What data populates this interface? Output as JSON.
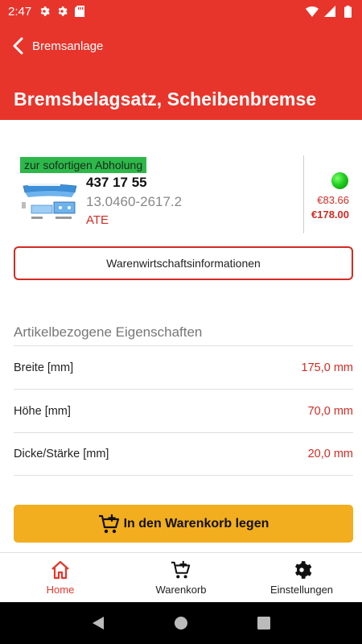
{
  "status_bar": {
    "time": "2:47",
    "left_icons": [
      "gear-icon",
      "gear-icon",
      "sd-card-icon"
    ],
    "right_icons": [
      "wifi-icon",
      "signal-icon",
      "battery-icon"
    ]
  },
  "header": {
    "back_label": "Bremsanlage",
    "title": "Bremsbelagsatz, Scheibenbremse",
    "color": "#e8352b"
  },
  "article": {
    "pickup_badge": "zur sofortigen Abholung",
    "article_number": "437 17 55",
    "reference": "13.0460-2617.2",
    "brand": "ATE",
    "stock_status_color": "#1fcf1f",
    "price_net": "€83.66",
    "price_gross": "€178.00"
  },
  "info_button": {
    "label": "Warenwirtschaftsinformationen"
  },
  "properties": {
    "title": "Artikelbezogene Eigenschaften",
    "rows": [
      {
        "label": "Breite [mm]",
        "value": "175,0 mm"
      },
      {
        "label": "Höhe [mm]",
        "value": "70,0 mm"
      },
      {
        "label": "Dicke/Stärke [mm]",
        "value": "20,0 mm"
      }
    ]
  },
  "cart_button": {
    "label": "In den Warenkorb legen",
    "color": "#f2ae1e"
  },
  "bottom_nav": {
    "items": [
      {
        "label": "Home",
        "icon": "home-icon",
        "active": true
      },
      {
        "label": "Warenkorb",
        "icon": "cart-icon",
        "active": false
      },
      {
        "label": "Einstellungen",
        "icon": "gear-icon",
        "active": false
      }
    ]
  },
  "system_nav": {
    "buttons": [
      "back-triangle-icon",
      "home-circle-icon",
      "recents-square-icon"
    ]
  }
}
